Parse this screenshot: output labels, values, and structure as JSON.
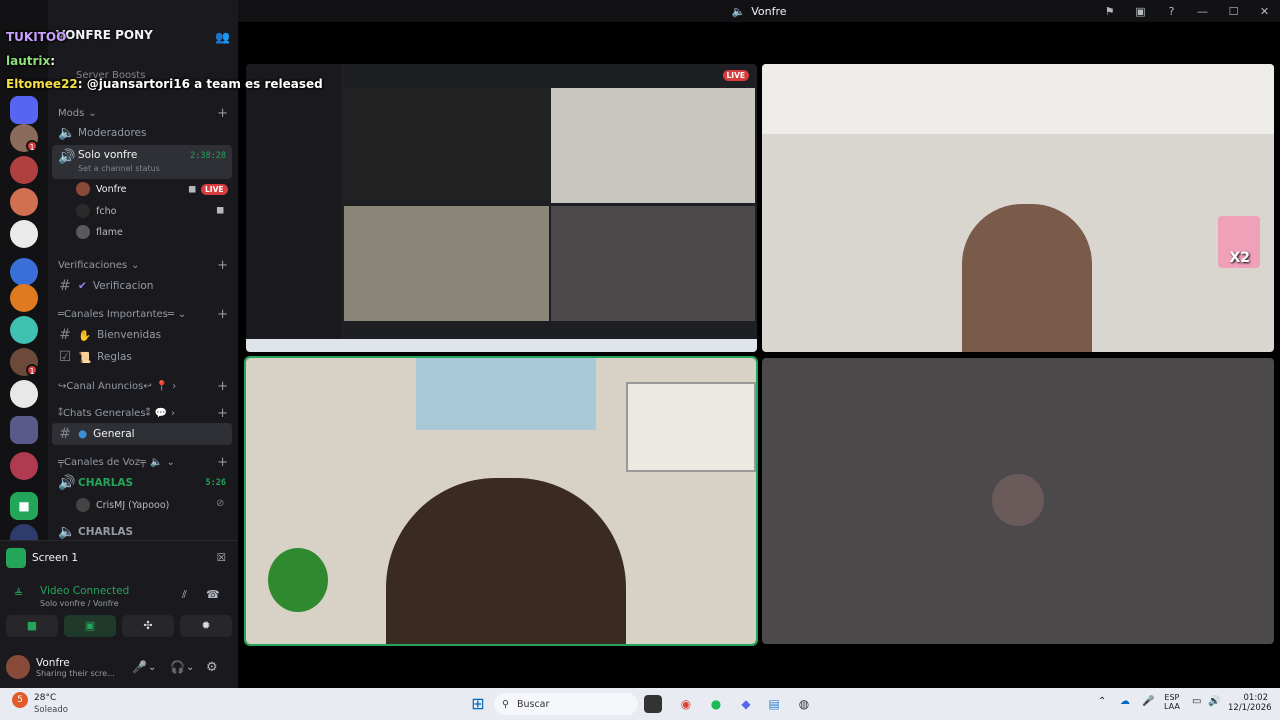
{
  "window": {
    "title": "Vonfre"
  },
  "server": {
    "name": "VONFRE PONY",
    "boosts": "Server Boosts"
  },
  "chat_overlay": [
    {
      "name": "TUKITOO",
      "text": ""
    },
    {
      "name": "lautrix",
      "text": ": "
    },
    {
      "name": "Eltomee22",
      "text": ": @juansartori16 a team es released"
    }
  ],
  "channels": {
    "mods_category": "Mods",
    "moderadores": "Moderadores",
    "solo_vonfre": "Solo vonfre",
    "solo_vonfre_timer": "2:38:28",
    "channel_status": "Set a channel status",
    "users": [
      {
        "name": "Vonfre",
        "live": "LIVE"
      },
      {
        "name": "fcho"
      },
      {
        "name": "flame"
      }
    ],
    "verificaciones_category": "Verificaciones",
    "verificacion": "Verificacion",
    "importantes_category": "═Canales Importantes═",
    "bienvenidas": "Bienvenidas",
    "reglas": "Reglas",
    "anuncios_category": "↪Canal Anuncios↩",
    "generales_category": "⁑Chats Generales⁑",
    "general": "General",
    "voz_category": "╤Canales de Voz╤",
    "charlas": "CHARLAS",
    "charlas_timer": "5:26",
    "charlas_user": "CrisMJ (Yapooo)",
    "charlas2": "CHARLAS"
  },
  "voice_panel": {
    "screen_label": "Screen 1",
    "status": "Video Connected",
    "location": "Solo vonfre / Vonfre"
  },
  "user_area": {
    "name": "Vonfre",
    "status": "Sharing their scre..."
  },
  "stage": {
    "live_badge": "LIVE",
    "focus_name": "X2"
  },
  "taskbar": {
    "weather_temp": "28°C",
    "weather_desc": "Soleado",
    "search_placeholder": "Buscar",
    "lang1": "ESP",
    "lang2": "LAA",
    "time": "01:02",
    "date": "12/1/2026",
    "notif_count": "5"
  },
  "colors": {
    "accent_green": "#23a55a",
    "live_red": "#d83c3e",
    "rail_bg": "#121214"
  }
}
